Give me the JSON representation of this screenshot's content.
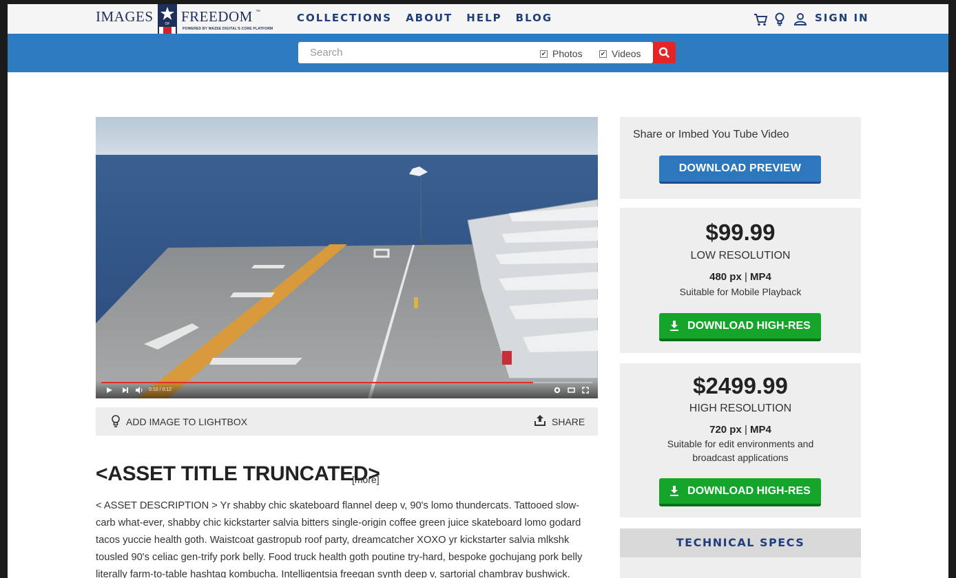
{
  "brand": {
    "left_word": "IMAGES",
    "right_word": "FREEDOM",
    "trademark": "™",
    "of": "OF",
    "tagline": "POWERED BY WAZEE DIGITAL'S CORE PLATFORM"
  },
  "nav": {
    "items": [
      "COLLECTIONS",
      "ABOUT",
      "HELP",
      "BLOG"
    ],
    "sign_in": "SIGN IN"
  },
  "search": {
    "placeholder": "Search",
    "photos_label": "Photos",
    "videos_label": "Videos",
    "photos_checked": true,
    "videos_checked": true
  },
  "player": {
    "time": "0:10 / 0:12",
    "progress": 0.88
  },
  "actions": {
    "lightbox": "ADD IMAGE TO LIGHTBOX",
    "share": "SHARE"
  },
  "asset": {
    "title": "<ASSET TITLE TRUNCATED>",
    "more": "[more]",
    "description": "< ASSET DESCRIPTION >  Yr shabby chic skateboard flannel deep v, 90's lomo thundercats. Tattooed slow-carb what-ever, shabby chic kickstarter salvia bitters single-origin coffee green juice skateboard lomo godard tacos yuccie health goth. Waistcoat gastropub roof party, dreamcatcher XOXO yr kickstarter salvia mlkshk tousled 90's celiac gen-trify pork belly. Food truck health goth poutine try-hard, bespoke gochujang pork belly literally farm-to-table hashtag kombucha. Intelligentsia freegan synth deep v, sartorial chambray bushwick. Fingerstache asymmetrical trust fund."
  },
  "preview": {
    "share_text": "Share or Imbed You Tube Video",
    "button": "DOWNLOAD PREVIEW"
  },
  "offers": [
    {
      "price": "$99.99",
      "resolution": "LOW RESOLUTION",
      "px": "480 px",
      "sep": " | ",
      "format": "MP4",
      "note": "Suitable for Mobile Playback",
      "button": "DOWNLOAD HIGH-RES"
    },
    {
      "price": "$2499.99",
      "resolution": "HIGH RESOLUTION",
      "px": "720 px",
      "sep": " | ",
      "format": "MP4",
      "note": "Suitable for edit environments and broadcast applications",
      "button": "DOWNLOAD HIGH-RES"
    }
  ],
  "tech_specs": "TECHNICAL SPECS",
  "colors": {
    "nav_blue": "#1f3e7c",
    "search_bar": "#2e7cbf",
    "search_button": "#e42526",
    "download_green": "#15a52b",
    "preview_blue": "#2d78bd"
  }
}
